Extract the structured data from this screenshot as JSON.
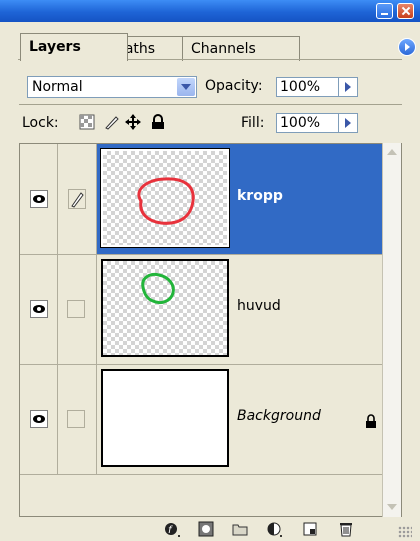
{
  "tabs": [
    {
      "label": "Layers",
      "active": true
    },
    {
      "label": "Paths",
      "active": false
    },
    {
      "label": "Channels",
      "active": false
    }
  ],
  "blend_mode": {
    "value": "Normal"
  },
  "opacity": {
    "label": "Opacity:",
    "value": "100%"
  },
  "lock": {
    "label": "Lock:"
  },
  "fill": {
    "label": "Fill:",
    "value": "100%"
  },
  "layers": [
    {
      "name": "kropp",
      "selected": true,
      "visible": true,
      "thumb_stroke": "#e8323c"
    },
    {
      "name": "huvud",
      "selected": false,
      "visible": true,
      "thumb_stroke": "#22b53a"
    },
    {
      "name": "Background",
      "selected": false,
      "visible": true,
      "locked": true
    }
  ],
  "colors": {
    "selection": "#316ac5",
    "titlebar": "#1e64d6",
    "panel": "#ece9d8"
  },
  "bottom_icons": [
    "layer-style-icon",
    "layer-mask-icon",
    "new-group-icon",
    "adjustment-layer-icon",
    "new-layer-icon",
    "trash-icon"
  ]
}
